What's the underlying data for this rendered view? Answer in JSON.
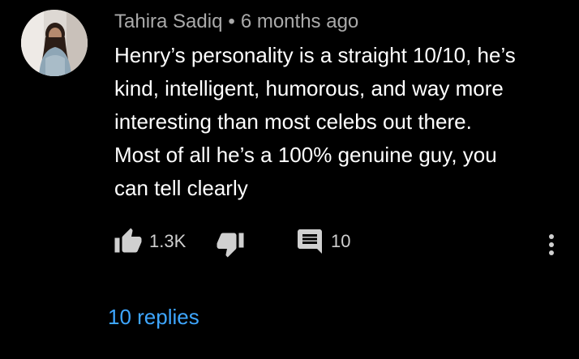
{
  "comment": {
    "author": "Tahira Sadiq",
    "separator": "•",
    "timestamp": "6 months ago",
    "text_lines": [
      "Henry’s personality is a straight 10/10, he’s",
      "kind, intelligent, humorous, and way more",
      "interesting than most celebs out there.",
      "Most of all he’s a 100% genuine guy, you",
      "can tell clearly"
    ],
    "likes": "1.3K",
    "replies_count": "10",
    "replies_link": "10 replies"
  },
  "icons": {
    "like": "thumbs-up-icon",
    "dislike": "thumbs-down-icon",
    "reply": "comment-icon",
    "menu": "more-vertical-icon"
  },
  "colors": {
    "background": "#000000",
    "text": "#ffffff",
    "meta": "#aaaaaa",
    "link": "#3ea6ff"
  }
}
